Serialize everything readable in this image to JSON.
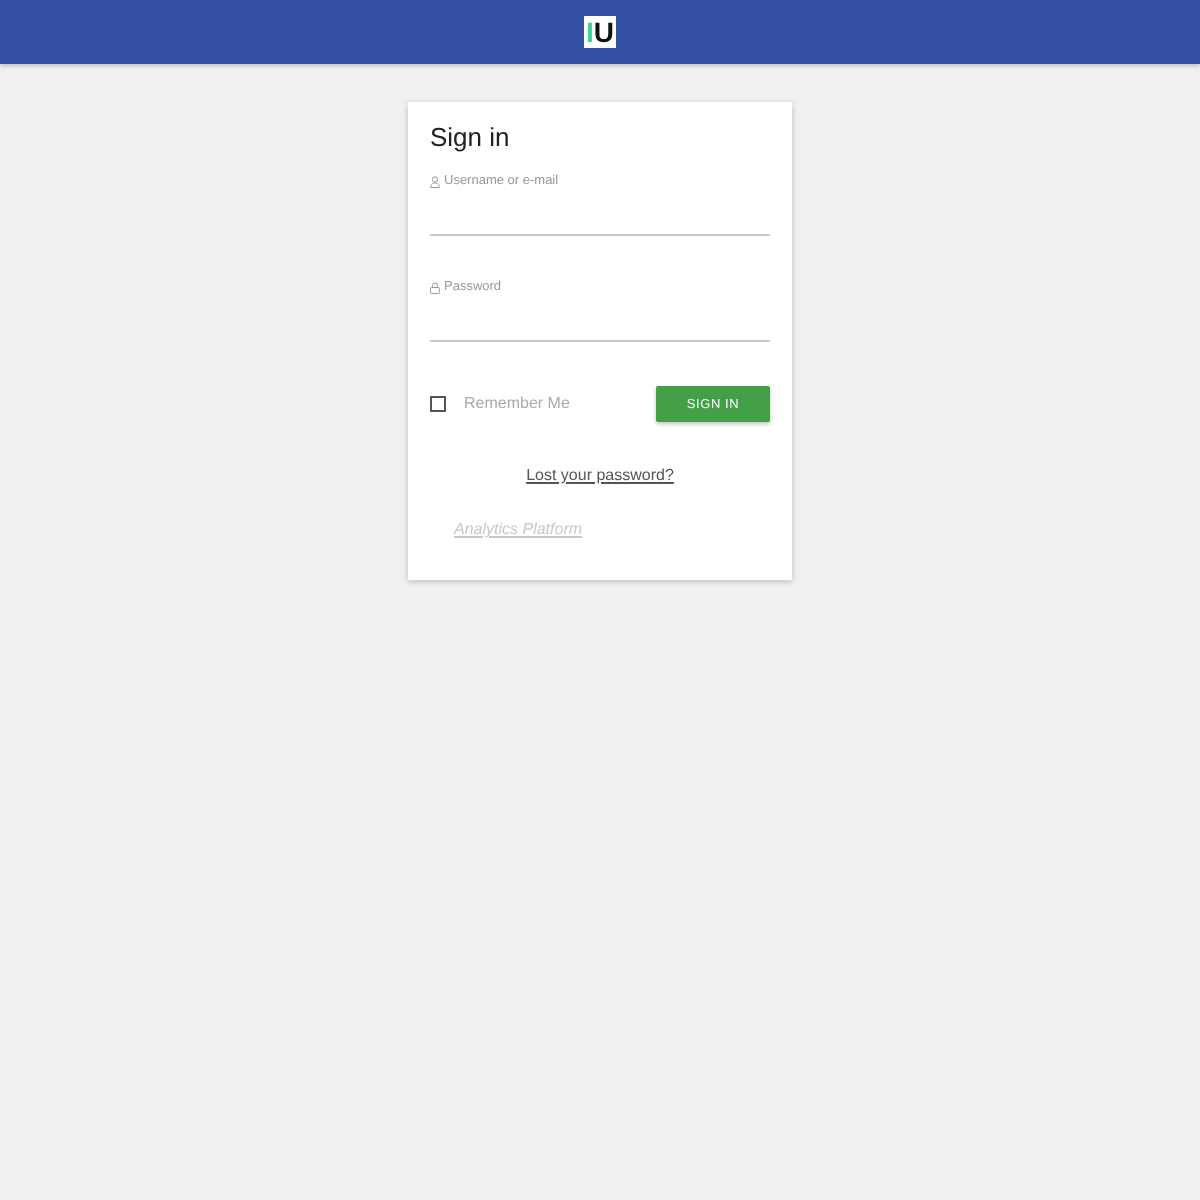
{
  "header": {
    "logo": "IU"
  },
  "card": {
    "title": "Sign in",
    "fields": [
      {
        "kind": "user",
        "label": "Username or e-mail"
      },
      {
        "kind": "password",
        "label": "Password"
      }
    ],
    "remember": {
      "label": "Remember Me",
      "checked": false
    },
    "button": "SIGN IN",
    "lost_password_link": "Lost your password?",
    "footer_link": "Analytics Platform"
  }
}
